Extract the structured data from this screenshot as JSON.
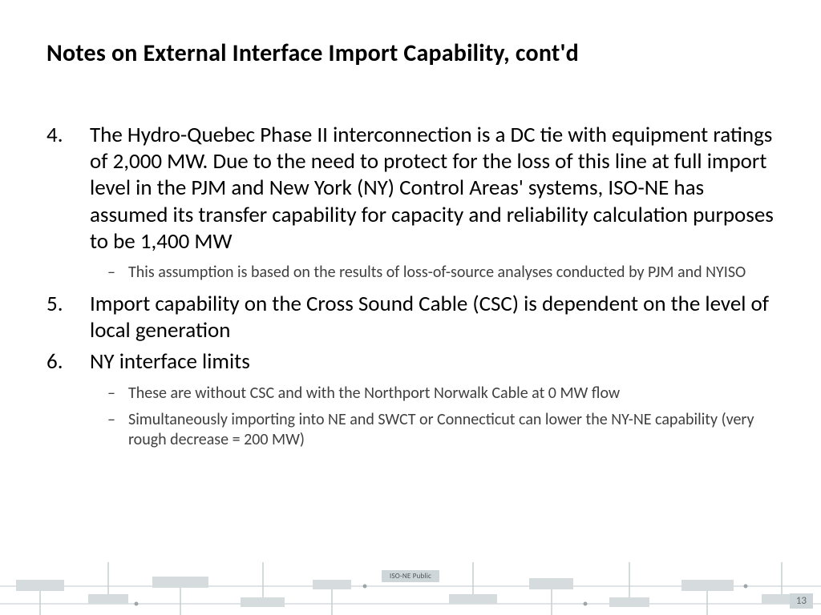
{
  "title": "Notes on External Interface Import Capability, cont'd",
  "items": [
    {
      "text": "The Hydro-Quebec Phase II interconnection is a DC tie with equipment ratings of 2,000 MW. Due to the need to protect for the loss of this line at full import level in the PJM and New York (NY) Control Areas' systems, ISO-NE has assumed its transfer capability for capacity and reliability calculation purposes to be 1,400 MW",
      "sub": [
        "This assumption is based on the results of loss-of-source analyses conducted by PJM and NYISO"
      ]
    },
    {
      "text": "Import capability on the Cross Sound Cable (CSC) is dependent on the level of local generation",
      "sub": []
    },
    {
      "text": "NY interface limits",
      "sub": [
        "These are without CSC and with the Northport Norwalk Cable at 0 MW flow",
        "Simultaneously importing into NE and SWCT or Connecticut can lower the NY-NE capability (very rough decrease = 200 MW)"
      ]
    }
  ],
  "footer": {
    "label": "ISO-NE Public",
    "page": "13"
  }
}
